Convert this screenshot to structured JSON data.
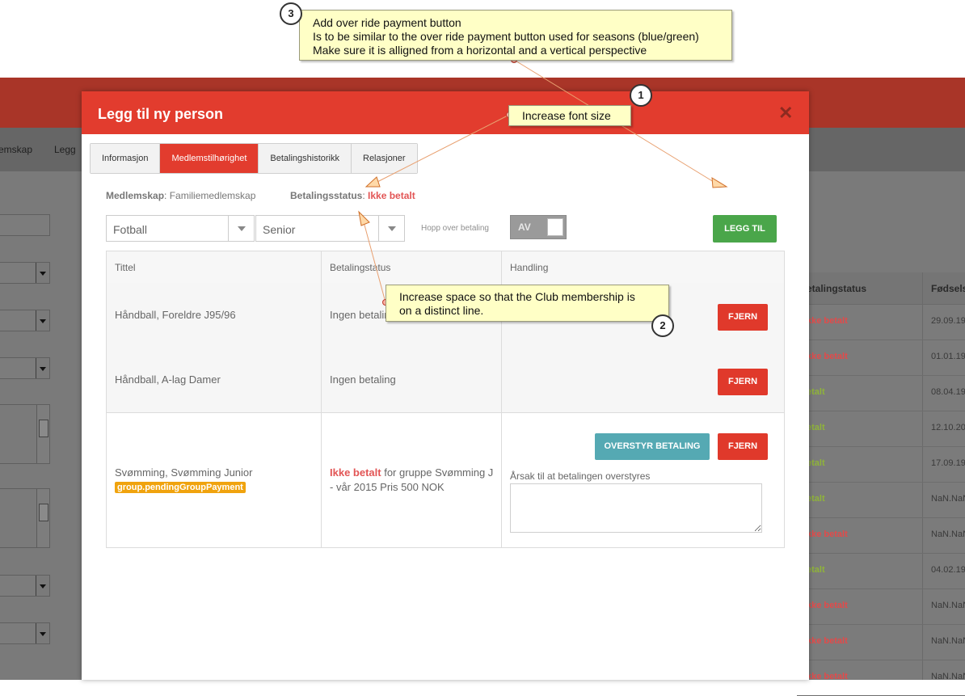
{
  "background": {
    "tabs": [
      "emskap",
      "Legg"
    ],
    "table": {
      "headers": [
        "etalingstatus",
        "Fødsels"
      ],
      "rows": [
        {
          "status": "kke betalt",
          "date": "29.09.19",
          "color": "#e34a4a"
        },
        {
          "status": "kke betalt",
          "date": "01.01.19",
          "color": "#e34a4a"
        },
        {
          "status": "etalt",
          "date": "08.04.19",
          "color": "#8fb33a"
        },
        {
          "status": "etalt",
          "date": "12.10.20",
          "color": "#8fb33a"
        },
        {
          "status": "etalt",
          "date": "17.09.19",
          "color": "#8fb33a"
        },
        {
          "status": "etalt",
          "date": "NaN.NaN",
          "color": "#8fb33a"
        },
        {
          "status": "kke betalt",
          "date": "NaN.NaN",
          "color": "#e34a4a"
        },
        {
          "status": "etalt",
          "date": "04.02.19",
          "color": "#8fb33a"
        },
        {
          "status": "kke betalt",
          "date": "NaN.NaN",
          "color": "#e34a4a"
        },
        {
          "status": "kke betalt",
          "date": "NaN.NaN",
          "color": "#e34a4a"
        },
        {
          "status": "kke betalt",
          "date": "NaN.NaN",
          "color": "#e34a4a"
        }
      ]
    }
  },
  "modal": {
    "title": "Legg til ny person",
    "close_icon": "close-icon",
    "tabs": [
      "Informasjon",
      "Medlemstilhørighet",
      "Betalingshistorikk",
      "Relasjoner"
    ],
    "active_tab": "Medlemstilhørighet",
    "membership_label": "Medlemskap",
    "membership_value": ": Familiemedlemskap",
    "payment_status_label": "Betalingsstatus",
    "payment_status_colon": ": ",
    "payment_status_value": "Ikke betalt",
    "sport_select": "Fotball",
    "level_select": "Senior",
    "skip_payment_label": "Hopp over betaling",
    "toggle_label": "AV",
    "add_button": "LEGG TIL",
    "table": {
      "headers": [
        "Tittel",
        "Betalingstatus",
        "Handling"
      ],
      "rows": [
        {
          "title": "Håndball, Foreldre J95/96",
          "status": "Ingen betaling",
          "action": "FJERN"
        },
        {
          "title": "Håndball, A-lag Damer",
          "status": "Ingen betaling",
          "action": "FJERN"
        },
        {
          "title": "Svømming, Svømming Junior",
          "badge": "group.pendingGroupPayment",
          "status_red": "Ikke betalt",
          "status_rest_1": " for gruppe Svømming J",
          "status_rest_2": "- vår 2015 Pris 500 NOK",
          "override_button": "OVERSTYR BETALING",
          "action": "FJERN",
          "reason_label": "Årsak til at betalingen overstyres",
          "reason_value": ""
        }
      ]
    }
  },
  "callouts": {
    "c1": {
      "number": "1",
      "text": "Increase font size"
    },
    "c2": {
      "number": "2",
      "line1": "Increase space so that the Club membership is",
      "line2": "on a distinct line."
    },
    "c3": {
      "number": "3",
      "line1": "Add over ride payment button",
      "line2": "Is to be similar to the over ride payment button used for seasons (blue/green)",
      "line3": "Make sure it is alligned from a horizontal and a vertical perspective"
    }
  },
  "colors": {
    "header_red": "#e23c2e",
    "button_green": "#4aa64a",
    "button_teal": "#55a9b3",
    "badge_orange": "#f0a30e",
    "callout_yellow": "#ffffc6"
  }
}
